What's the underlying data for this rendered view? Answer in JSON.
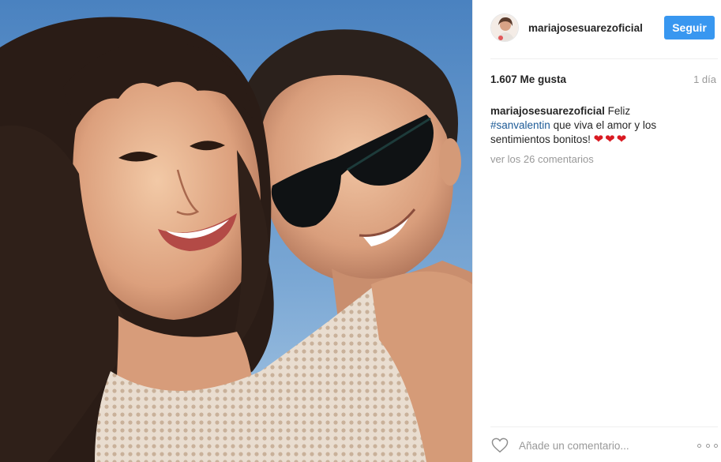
{
  "photo": {
    "description_icon": "selfie-photo",
    "sky_color": "#6a9ccf"
  },
  "header": {
    "username": "mariajosesuarezoficial",
    "follow_label": "Seguir",
    "follow_color": "#3897f0"
  },
  "stats": {
    "likes": "1.607 Me gusta",
    "time": "1 día"
  },
  "caption": {
    "username": "mariajosesuarezoficial",
    "text_before_tag": "Feliz",
    "hashtag": "#sanvalentin",
    "text_after_tag": "que viva el amor y los sentimientos bonitos!",
    "hearts": "❤❤❤",
    "hashtag_color": "#1c5a96",
    "heart_color": "#d91a22"
  },
  "comments": {
    "view_all": "ver los 26 comentarios"
  },
  "comment_bar": {
    "placeholder": "Añade un comentario...",
    "like_icon": "heart-outline-icon",
    "more_icon": "more-options-icon"
  }
}
